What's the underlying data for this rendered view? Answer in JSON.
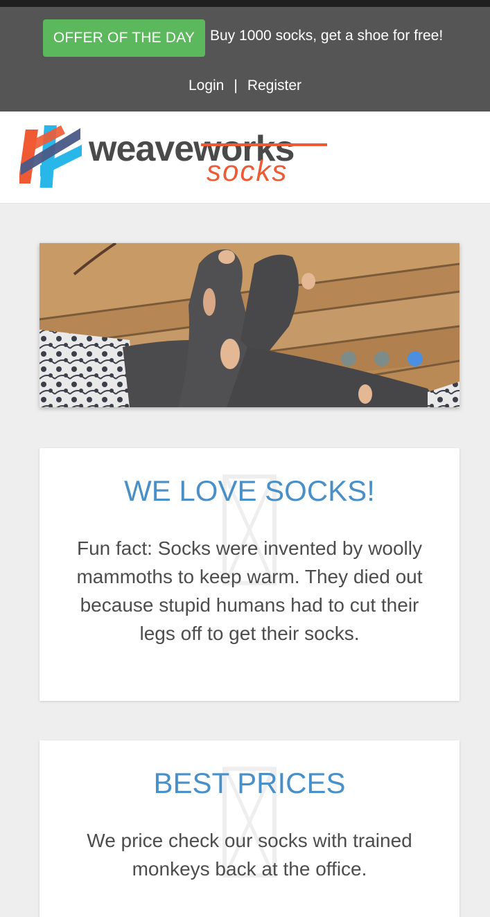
{
  "topbar": {
    "offer_button": "OFFER OF THE DAY",
    "offer_text": "Buy 1000 socks, get a shoe for free!",
    "login": "Login",
    "separator": "|",
    "register": "Register"
  },
  "header": {
    "logo_word": "weave",
    "logo_word_struck": "works",
    "logo_sub": "socks"
  },
  "carousel": {
    "slide_count": 3,
    "active_slide": 3
  },
  "cards": [
    {
      "title": "WE LOVE SOCKS!",
      "text": "Fun fact: Socks were invented by woolly mammoths to keep warm. They died out because stupid humans had to cut their legs off to get their socks."
    },
    {
      "title": "BEST PRICES",
      "text": "We price check our socks with trained monkeys back at the office."
    }
  ],
  "colors": {
    "topbar_bg": "#555555",
    "offer_green": "#5cb85c",
    "title_blue": "#4a90c8",
    "brand_orange": "#ef5a34",
    "dot_active": "#4a8fe0"
  }
}
